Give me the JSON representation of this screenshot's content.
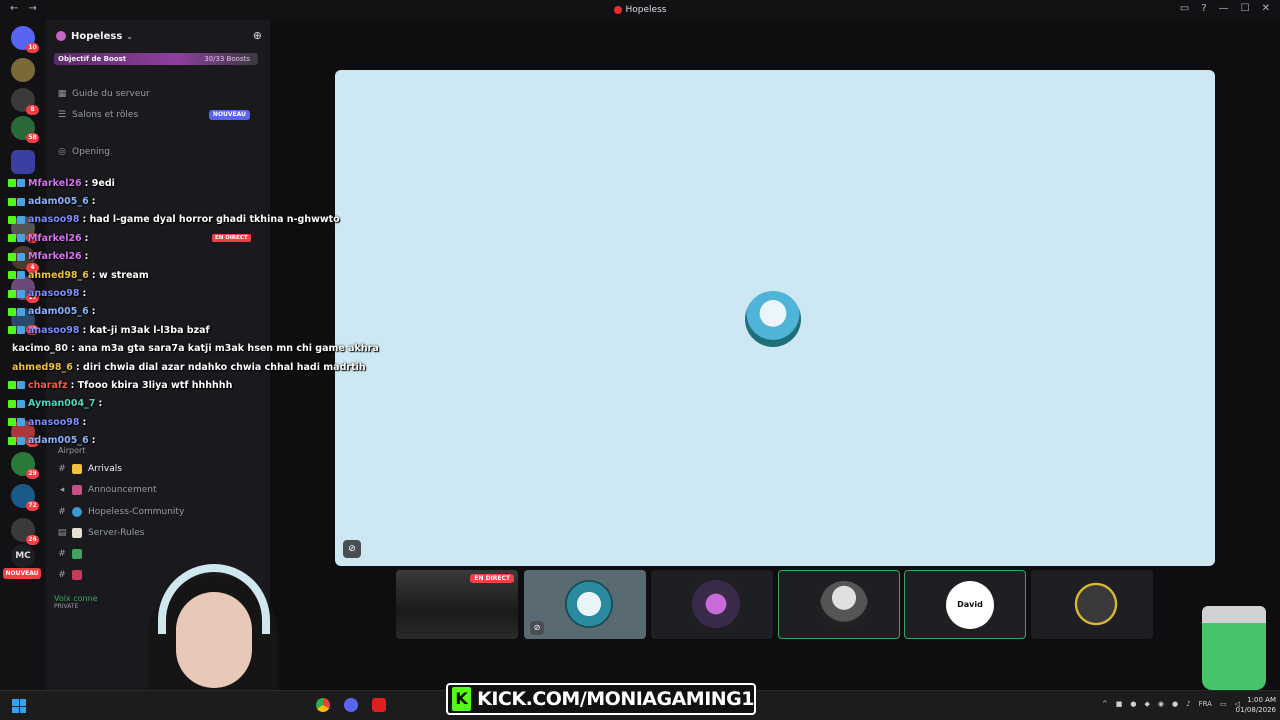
{
  "window": {
    "title": "Hopeless"
  },
  "servers": {
    "badges": [
      "10",
      "8",
      "58",
      "27",
      "4",
      "17",
      "28",
      "75",
      "29",
      "72",
      "26"
    ],
    "mc_label": "MC",
    "new_label": "NOUVEAU"
  },
  "guild": {
    "name": "Hopeless",
    "boost_label": "Objectif de Boost",
    "boost_progress": "30/33 Boosts",
    "boost_fraction": 0.909
  },
  "channels": {
    "guide": "Guide du serveur",
    "roles": "Salons et rôles",
    "roles_badge": "NOUVEAU",
    "opening": "Opening",
    "live_badge": "EN DIRECT",
    "category_airport": "Airport",
    "arrivals": "Arrivals",
    "announcement": "Announcement",
    "community": "Hopeless-Community",
    "rules": "Server-Rules"
  },
  "voice": {
    "status": "Voix conne",
    "sub": "PRIVATE"
  },
  "chat": [
    {
      "user": "Mfarkel26",
      "color": "#d774f0",
      "message": ": 9edi"
    },
    {
      "user": "adam005_6",
      "color": "#8ab4ff",
      "message": ":"
    },
    {
      "user": "anasoo98",
      "color": "#7b8cff",
      "message": ": had l-game dyal horror ghadi tkhina n-ghwwto"
    },
    {
      "user": "Mfarkel26",
      "color": "#d774f0",
      "message": ":"
    },
    {
      "user": "Mfarkel26",
      "color": "#d774f0",
      "message": ":"
    },
    {
      "user": "ahmed98_6",
      "color": "#f0c040",
      "message": ": w stream"
    },
    {
      "user": "anasoo98",
      "color": "#7b8cff",
      "message": ":"
    },
    {
      "user": "adam005_6",
      "color": "#8ab4ff",
      "message": ":"
    },
    {
      "user": "anasoo98",
      "color": "#7b8cff",
      "message": ": kat-ji m3ak l-l3ba bzaf"
    },
    {
      "user": "kacimo_80",
      "color": "#f0f0f0",
      "message": ": ana m3a gta sara7a katji m3ak hsen mn chi game akhra"
    },
    {
      "user": "ahmed98_6",
      "color": "#f0c040",
      "message": ": diri chwia dial azar ndahko chwia chhal hadi madrtih"
    },
    {
      "user": "charafz",
      "color": "#ff5a3c",
      "message": ": Tfooo kbira 3liya wtf hhhhhh"
    },
    {
      "user": "Ayman004_7",
      "color": "#4ad6c0",
      "message": ":"
    },
    {
      "user": "anasoo98",
      "color": "#7b8cff",
      "message": ":"
    },
    {
      "user": "adam005_6",
      "color": "#8ab4ff",
      "message": ":"
    }
  ],
  "stage": {
    "tiles": [
      {
        "kind": "stream",
        "live_label": "EN DIRECT"
      },
      {
        "kind": "avatar",
        "speaking": false
      },
      {
        "kind": "avatar",
        "speaking": false
      },
      {
        "kind": "avatar",
        "speaking": true
      },
      {
        "kind": "avatar",
        "speaking": true,
        "label": "David Leoo"
      },
      {
        "kind": "avatar",
        "speaking": false
      }
    ]
  },
  "overlay": {
    "kick_url": "KICK.COM/MONIAGAMING1"
  },
  "taskbar": {
    "lang": "FRA",
    "time": "1:00 AM",
    "date": "01/08/2026"
  },
  "colors": {
    "accent": "#5865f2",
    "live": "#ed4245",
    "speaking": "#3ba55c",
    "kick": "#53fc18"
  }
}
